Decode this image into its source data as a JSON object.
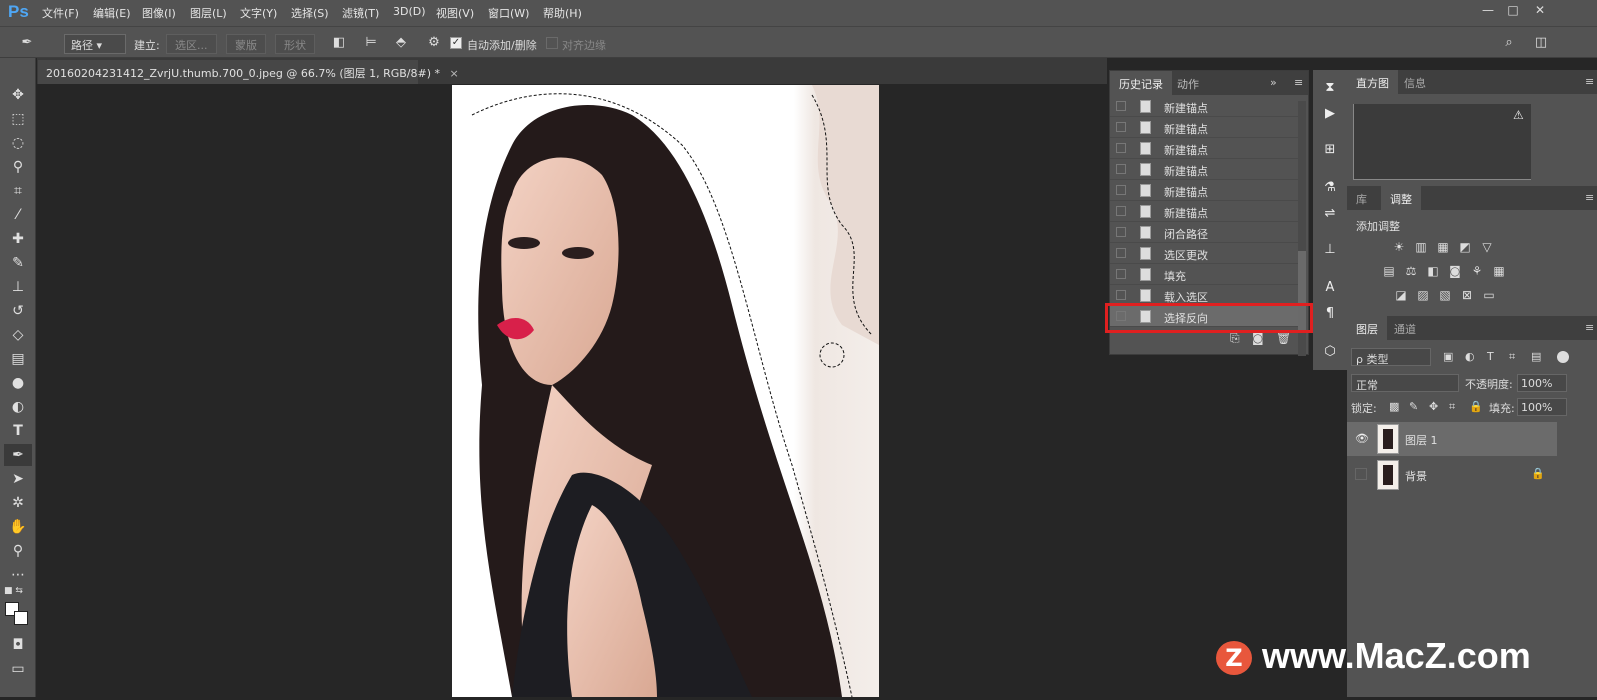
{
  "app": {
    "logo": "Ps"
  },
  "menu": [
    "文件(F)",
    "编辑(E)",
    "图像(I)",
    "图层(L)",
    "文字(Y)",
    "选择(S)",
    "滤镜(T)",
    "3D(D)",
    "视图(V)",
    "窗口(W)",
    "帮助(H)"
  ],
  "window_buttons": [
    "—",
    "□",
    "✕"
  ],
  "options": {
    "path_mode": "路径",
    "build_label": "建立:",
    "btn_selection": "选区...",
    "btn_mask": "蒙版",
    "btn_shape": "形状",
    "auto_add_delete": "自动添加/删除",
    "align_edges": "对齐边缘",
    "auto_checked": true
  },
  "document": {
    "tab_title": "20160204231412_ZvrjU.thumb.700_0.jpeg @ 66.7% (图层 1, RGB/8#) *",
    "close": "×"
  },
  "history": {
    "tabs": [
      "历史记录",
      "动作"
    ],
    "items": [
      "新建锚点",
      "新建锚点",
      "新建锚点",
      "新建锚点",
      "新建锚点",
      "新建锚点",
      "闭合路径",
      "选区更改",
      "填充",
      "载入选区",
      "选择反向"
    ],
    "selected_index": 10
  },
  "histogram": {
    "tabs": [
      "直方图",
      "信息"
    ],
    "warning": "⚠"
  },
  "adjustments": {
    "tabs": [
      "库",
      "调整"
    ],
    "title": "添加调整"
  },
  "layers": {
    "tabs": [
      "图层",
      "通道"
    ],
    "filter": "ρ 类型",
    "blend": "正常",
    "opacity_label": "不透明度:",
    "opacity": "100%",
    "lock_label": "锁定:",
    "fill_label": "填充:",
    "fill": "100%",
    "items": [
      {
        "name": "图层 1",
        "visible": true,
        "selected": true
      },
      {
        "name": "背景",
        "visible": false,
        "selected": false,
        "locked": true
      }
    ]
  },
  "watermark": {
    "logo": "Z",
    "text": "www.MacZ.com"
  },
  "colors": {
    "accent_red": "#e02020",
    "ps_blue": "#4fa7f5"
  }
}
